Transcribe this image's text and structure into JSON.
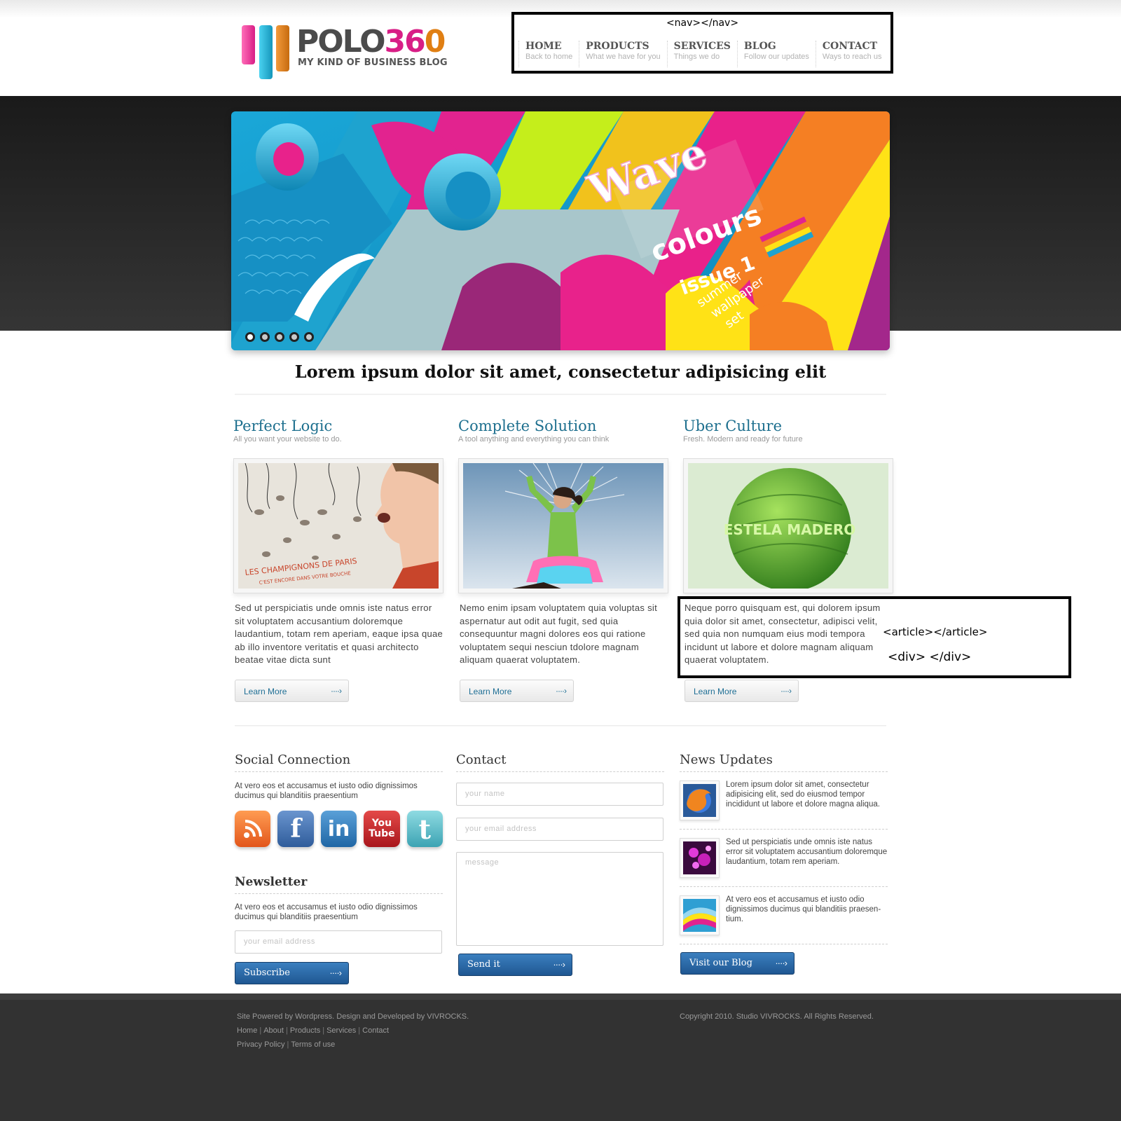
{
  "logo": {
    "word_1": "POLO",
    "word_2": "36",
    "word_3": "0",
    "tagline": "MY KIND OF BUSINESS BLOG"
  },
  "nav": {
    "annotation": "<nav></nav>",
    "items": [
      {
        "title": "HOME",
        "sub": "Back to home"
      },
      {
        "title": "PRODUCTS",
        "sub": "What we have for you"
      },
      {
        "title": "SERVICES",
        "sub": "Things we do"
      },
      {
        "title": "BLOG",
        "sub": "Follow our updates"
      },
      {
        "title": "CONTACT",
        "sub": "Ways to reach us"
      }
    ]
  },
  "slider": {
    "title": "Wave",
    "title_2": "colours",
    "issue": "issue 1",
    "caption_lines": [
      "summer",
      "wallpaper",
      "set"
    ],
    "dots": 5,
    "active_dot": 1
  },
  "headline": "Lorem ipsum dolor sit amet, consectetur adipisicing elit",
  "features": [
    {
      "title": "Perfect Logic",
      "sub": "All you want your website to do.",
      "image_text": "LES CHAMPIGNONS DE PARIS",
      "image_text_2": "C'EST ENCORE DANS VOTRE BOUCHE",
      "body": "Sed ut perspiciatis unde omnis iste natus error sit voluptatem accusantium doloremque laudantium, totam rem aperiam, eaque ipsa quae ab illo inventore veritatis et quasi architecto beatae vitae dicta sunt",
      "button": "Learn More"
    },
    {
      "title": "Complete Solution",
      "sub": "A tool anything and everything you can think",
      "body": "Nemo enim ipsam voluptatem quia voluptas sit aspernatur aut odit aut fugit, sed quia consequuntur magni dolores eos qui ratione voluptatem sequi nesciun tdolore magnam aliquam quaerat voluptatem.",
      "button": "Learn More"
    },
    {
      "title": "Uber Culture",
      "sub": "Fresh. Modern and ready for future",
      "image_text": "ESTELA MADERO",
      "body": "Neque porro quisquam est, qui dolorem ipsum quia dolor sit amet, consectetur, adipisci velit, sed quia non numquam eius modi tempora incidunt ut labore et dolore magnam aliquam quaerat voluptatem.",
      "button": "Learn More"
    }
  ],
  "annotations": {
    "article": "<article></article>",
    "div": "<div> </div>"
  },
  "social": {
    "title": "Social Connection",
    "text": "At vero eos et accusamus et iusto odio dignissimos ducimus qui blanditiis praesentium",
    "icons": [
      {
        "name": "rss-icon",
        "color": "#f07a28"
      },
      {
        "name": "facebook-icon",
        "label": "f",
        "color": "#3f6aa8"
      },
      {
        "name": "linkedin-icon",
        "label": "in",
        "color": "#2c78b7"
      },
      {
        "name": "youtube-icon",
        "label_1": "You",
        "label_2": "Tube",
        "color": "#c8262a"
      },
      {
        "name": "twitter-icon",
        "label": "t",
        "color": "#5cbfcc"
      }
    ]
  },
  "newsletter": {
    "title": "Newsletter",
    "text": "At vero eos et accusamus et iusto odio dignissimos ducimus qui blanditiis praesentium",
    "placeholder": "your email address",
    "button": "Subscribe"
  },
  "contact": {
    "title": "Contact",
    "name_placeholder": "your name",
    "email_placeholder": "your email address",
    "message_placeholder": "message",
    "button": "Send it"
  },
  "news": {
    "title": "News Updates",
    "items": [
      {
        "icon": "firefox-icon",
        "text": "Lorem ipsum dolor sit amet, consectetur adipisicing elit, sed do eiusmod tempor incididunt ut labore et dolore magna aliqua."
      },
      {
        "icon": "purple-lights-icon",
        "text": "Sed ut perspiciatis unde omnis iste natus error sit voluptatem accusantium doloremque laudantium, totam rem aperiam."
      },
      {
        "icon": "rainbow-wave-icon",
        "text": "At vero eos et accusamus et iusto odio dignissimos ducimus qui blanditiis praesen-tium."
      }
    ],
    "button": "Visit our Blog"
  },
  "footer": {
    "powered": "Site Powered by Wordpress. Design and Developed by VIVROCKS.",
    "links_1": [
      "Home",
      "About",
      "Products",
      "Services",
      "Contact"
    ],
    "links_2": [
      "Privacy Policy",
      "Terms of use"
    ],
    "copyright": "Copyright 2010. Studio VIVROCKS. All Rights Reserved."
  }
}
